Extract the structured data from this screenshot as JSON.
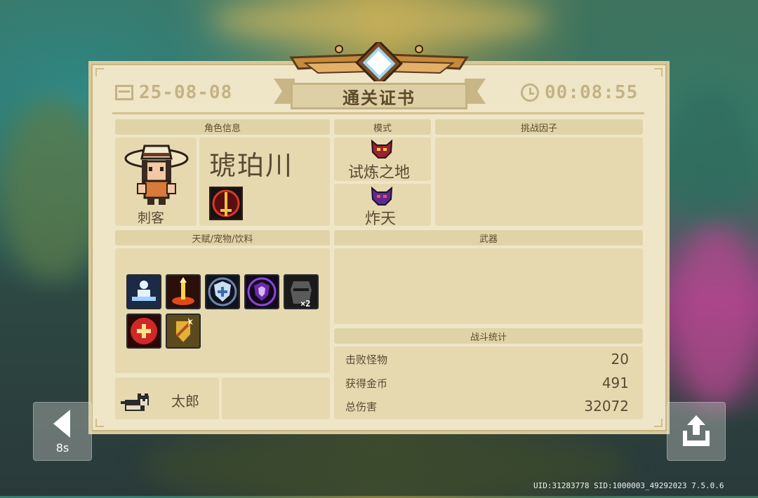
{
  "header": {
    "date": "25-08-08",
    "time": "00:08:55",
    "title": "通关证书"
  },
  "sections": {
    "character": "角色信息",
    "mode": "模式",
    "challenge": "挑战因子",
    "talents": "天赋/宠物/饮料",
    "weapons": "武器",
    "battle": "战斗统计"
  },
  "character": {
    "name": "琥珀川",
    "class": "刺客"
  },
  "modes": [
    {
      "label": "试炼之地"
    },
    {
      "label": "炸天"
    }
  ],
  "pet": {
    "name": "太郎"
  },
  "buffs": [
    {
      "icon": "meditation-icon"
    },
    {
      "icon": "fire-sword-icon"
    },
    {
      "icon": "frost-shield-icon"
    },
    {
      "icon": "purple-shield-icon"
    },
    {
      "icon": "knight-helmet-icon",
      "badge": "×2"
    },
    {
      "icon": "heart-plus-icon"
    },
    {
      "icon": "gold-shield-icon"
    }
  ],
  "stats": [
    {
      "label": "击败怪物",
      "value": "20"
    },
    {
      "label": "获得金币",
      "value": "491"
    },
    {
      "label": "总伤害",
      "value": "32072"
    }
  ],
  "controls": {
    "countdown": "8s"
  },
  "footer": {
    "uid": "UID:31283778 SID:1000003_49292023 7.5.0.6"
  },
  "colors": {
    "card": "#efe6c8",
    "panel": "#e6d9b0",
    "header": "#e0d3a8",
    "text": "#5a4a33",
    "accent": "#c3b284"
  }
}
